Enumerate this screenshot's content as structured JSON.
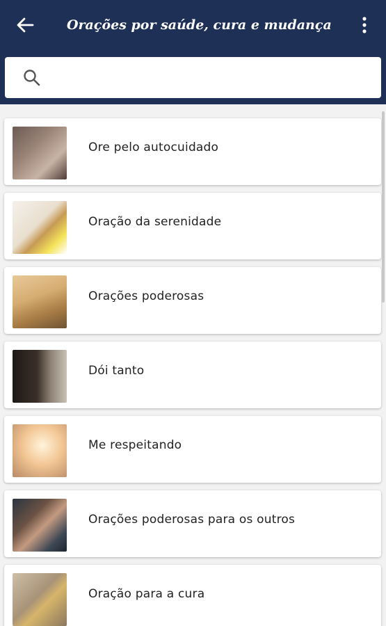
{
  "header": {
    "title": "Orações por saúde, cura e mudança",
    "back_icon": "arrow-left-icon",
    "menu_icon": "more-vertical-icon",
    "background": "#1f3057"
  },
  "search": {
    "value": "",
    "placeholder": "",
    "icon": "search-icon"
  },
  "items": [
    {
      "label": "Ore pelo autocuidado",
      "image": "praying-hands-photo"
    },
    {
      "label": "Oração da serenidade",
      "image": "child-sitting-photo"
    },
    {
      "label": "Orações poderosas",
      "image": "wheelchair-field-photo"
    },
    {
      "label": "Dói tanto",
      "image": "person-in-doorway-photo"
    },
    {
      "label": "Me respeitando",
      "image": "person-arms-open-sunlight-photo"
    },
    {
      "label": "Orações poderosas para os outros",
      "image": "group-hands-photo"
    },
    {
      "label": "Oração para a cura",
      "image": "rings-cross-photo"
    }
  ]
}
